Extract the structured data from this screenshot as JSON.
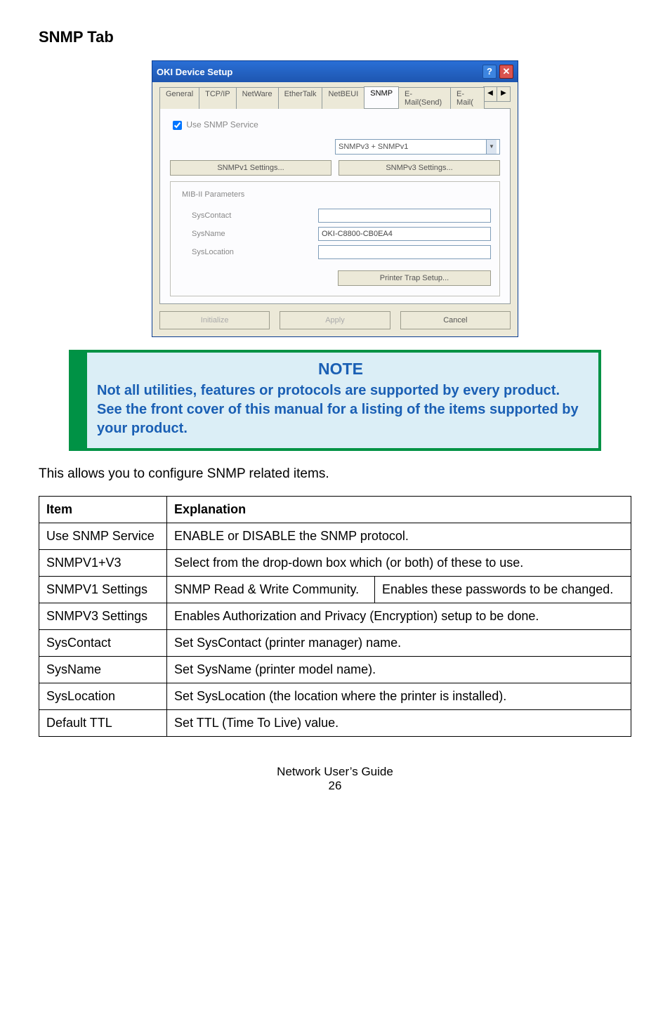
{
  "heading": "SNMP Tab",
  "dialog": {
    "title": "OKI Device Setup",
    "help_btn": "?",
    "close_btn": "✕",
    "tabs": [
      "General",
      "TCP/IP",
      "NetWare",
      "EtherTalk",
      "NetBEUI",
      "SNMP",
      "E-Mail(Send)",
      "E-Mail("
    ],
    "active_tab_index": 5,
    "arrow_left": "◀",
    "arrow_right": "▶",
    "use_snmp_label": "Use SNMP Service",
    "use_snmp_checked": true,
    "version_select": "SNMPv3 + SNMPv1",
    "btn_v1": "SNMPv1 Settings...",
    "btn_v3": "SNMPv3 Settings...",
    "fieldset_legend": "MIB-II Parameters",
    "syscontact_label": "SysContact",
    "syscontact_value": "",
    "sysname_label": "SysName",
    "sysname_value": "OKI-C8800-CB0EA4",
    "syslocation_label": "SysLocation",
    "syslocation_value": "",
    "btn_trap": "Printer Trap Setup...",
    "btn_initialize": "Initialize",
    "btn_apply": "Apply",
    "btn_cancel": "Cancel"
  },
  "note": {
    "title": "NOTE",
    "text": "Not all utilities, features or protocols are supported by every product. See the front cover of this manual for a listing of the items supported by your product."
  },
  "intro": "This allows you to configure SNMP related items.",
  "table": {
    "header_item": "Item",
    "header_expl": "Explanation",
    "rows": {
      "use_snmp": {
        "item": "Use SNMP Service",
        "expl": "ENABLE or DISABLE the SNMP protocol."
      },
      "snmpv1v3": {
        "item": "SNMPV1+V3",
        "expl": "Select from the drop-down box which (or both) of these to use."
      },
      "snmpv1": {
        "item": "SNMPV1 Settings",
        "sub": "SNMP Read & Write Community.",
        "expl": "Enables these passwords to be changed."
      },
      "snmpv3": {
        "item": "SNMPV3 Settings",
        "expl": "Enables Authorization and Privacy (Encryption) setup to be done."
      },
      "syscontact": {
        "item": "SysContact",
        "expl": "Set SysContact (printer manager) name."
      },
      "sysname": {
        "item": "SysName",
        "expl": "Set SysName (printer model name)."
      },
      "syslocation": {
        "item": "SysLocation",
        "expl": "Set SysLocation (the location where the printer is installed)."
      },
      "defaultttl": {
        "item": "Default TTL",
        "expl": "Set TTL (Time To Live) value."
      }
    }
  },
  "footer": {
    "guide": "Network User’s Guide",
    "page": "26"
  }
}
